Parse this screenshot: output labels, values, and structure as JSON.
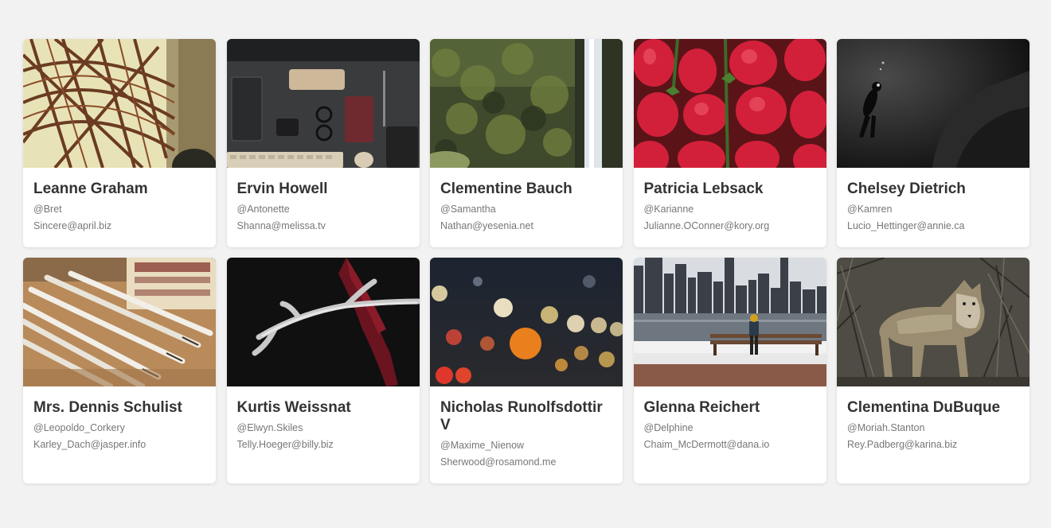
{
  "users": [
    {
      "name": "Leanne Graham",
      "username": "@Bret",
      "email": "Sincere@april.biz",
      "photo": "bridge-structure-photo"
    },
    {
      "name": "Ervin Howell",
      "username": "@Antonette",
      "email": "Shanna@melissa.tv",
      "photo": "desk-flatlay-photo"
    },
    {
      "name": "Clementine Bauch",
      "username": "@Samantha",
      "email": "Nathan@yesenia.net",
      "photo": "waterfall-photo"
    },
    {
      "name": "Patricia Lebsack",
      "username": "@Karianne",
      "email": "Julianne.OConner@kory.org",
      "photo": "strawberries-photo"
    },
    {
      "name": "Chelsey Dietrich",
      "username": "@Kamren",
      "email": "Lucio_Hettinger@annie.ca",
      "photo": "diver-photo"
    },
    {
      "name": "Mrs. Dennis Schulist",
      "username": "@Leopoldo_Corkery",
      "email": "Karley_Dach@jasper.info",
      "photo": "pencils-photo"
    },
    {
      "name": "Kurtis Weissnat",
      "username": "@Elwyn.Skiles",
      "email": "Telly.Hoeger@billy.biz",
      "photo": "antler-photo"
    },
    {
      "name": "Nicholas Runolfsdottir V",
      "username": "@Maxime_Nienow",
      "email": "Sherwood@rosamond.me",
      "photo": "bokeh-lights-photo"
    },
    {
      "name": "Glenna Reichert",
      "username": "@Delphine",
      "email": "Chaim_McDermott@dana.io",
      "photo": "city-skyline-photo"
    },
    {
      "name": "Clementina DuBuque",
      "username": "@Moriah.Stanton",
      "email": "Rey.Padberg@karina.biz",
      "photo": "coyote-photo"
    }
  ]
}
